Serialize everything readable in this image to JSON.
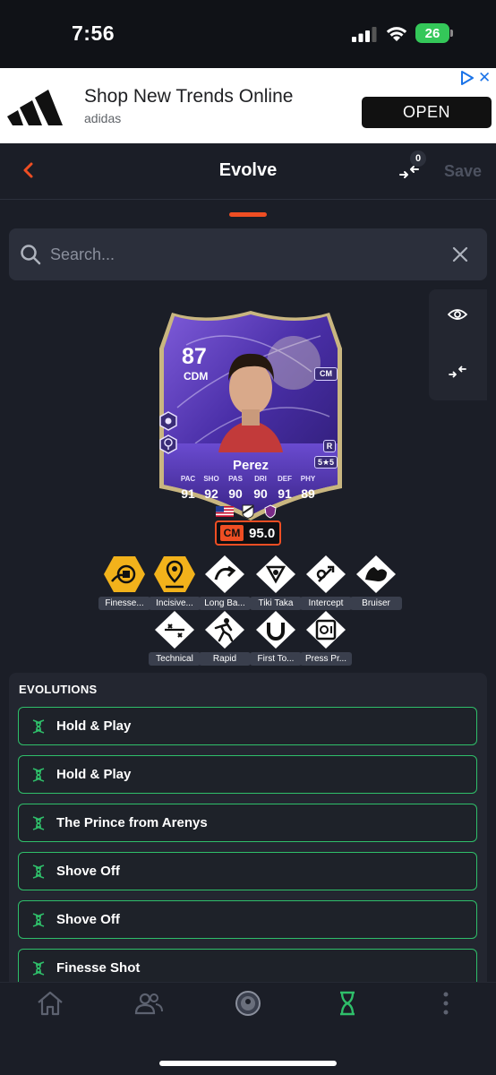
{
  "status_bar": {
    "time": "7:56",
    "battery": "26"
  },
  "ad": {
    "title": "Shop New Trends Online",
    "advertiser": "adidas",
    "cta": "OPEN"
  },
  "header": {
    "title": "Evolve",
    "compare_count": "0",
    "save_label": "Save"
  },
  "search": {
    "placeholder": "Search..."
  },
  "card": {
    "rating": "87",
    "position": "CDM",
    "alt_position": "CM",
    "preferred_foot": "R",
    "skill_weak": "5★5",
    "name": "Perez",
    "stats": [
      {
        "label": "PAC",
        "value": "91"
      },
      {
        "label": "SHO",
        "value": "92"
      },
      {
        "label": "PAS",
        "value": "90"
      },
      {
        "label": "DRI",
        "value": "90"
      },
      {
        "label": "DEF",
        "value": "91"
      },
      {
        "label": "PHY",
        "value": "89"
      }
    ],
    "evolved_position": "CM",
    "evolved_rating": "95.0"
  },
  "playstyles": [
    {
      "label": "Finesse...",
      "icon": "finesse-shot-icon",
      "plus": true
    },
    {
      "label": "Incisive...",
      "icon": "incisive-pass-icon",
      "plus": true
    },
    {
      "label": "Long Ba...",
      "icon": "long-ball-pass-icon",
      "plus": false
    },
    {
      "label": "Tiki Taka",
      "icon": "tiki-taka-icon",
      "plus": false
    },
    {
      "label": "Intercept",
      "icon": "intercept-icon",
      "plus": false
    },
    {
      "label": "Bruiser",
      "icon": "bruiser-icon",
      "plus": false
    },
    {
      "label": "Technical",
      "icon": "technical-icon",
      "plus": false
    },
    {
      "label": "Rapid",
      "icon": "rapid-icon",
      "plus": false
    },
    {
      "label": "First To...",
      "icon": "first-touch-icon",
      "plus": false
    },
    {
      "label": "Press Pr...",
      "icon": "press-proven-icon",
      "plus": false
    }
  ],
  "evolutions": {
    "heading": "EVOLUTIONS",
    "items": [
      "Hold & Play",
      "Hold & Play",
      "The Prince from Arenys",
      "Shove Off",
      "Shove Off",
      "Finesse Shot"
    ]
  },
  "colors": {
    "accent": "#ef4e23",
    "evolution_border": "#2fbf6a",
    "background": "#1b1e27",
    "plus_playstyle": "#f2b21b"
  },
  "nav": [
    "home-icon",
    "friends-icon",
    "club-icon",
    "evolve-icon",
    "more-icon"
  ]
}
